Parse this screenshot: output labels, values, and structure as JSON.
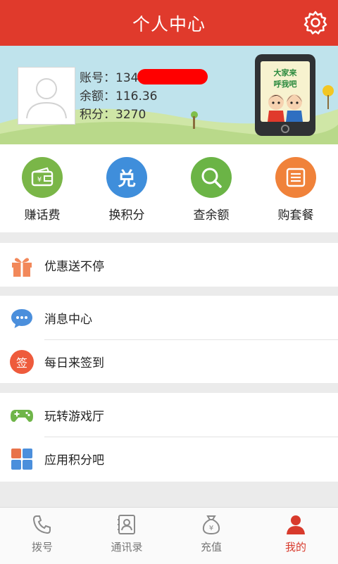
{
  "header": {
    "title": "个人中心",
    "settings_icon": "gear-icon"
  },
  "profile": {
    "account_label": "账号：",
    "account_value": "134",
    "balance_label": "余额：",
    "balance_value": "116.36",
    "points_label": "积分：",
    "points_value": "3270",
    "promo_line1": "大家来",
    "promo_line2": "呼我吧"
  },
  "actions": [
    {
      "label": "赚话费",
      "icon": "wallet-icon",
      "color": "#7ab648"
    },
    {
      "label": "换积分",
      "icon": "exchange-icon",
      "glyph": "兑",
      "color": "#3f8edb"
    },
    {
      "label": "查余额",
      "icon": "search-icon",
      "color": "#6bb446"
    },
    {
      "label": "购套餐",
      "icon": "list-icon",
      "color": "#f0823a"
    }
  ],
  "menu": [
    {
      "label": "优惠送不停",
      "icon": "gift-icon"
    },
    {
      "label": "消息中心",
      "icon": "chat-icon"
    },
    {
      "label": "每日来签到",
      "icon": "sign-in-icon",
      "glyph": "签"
    },
    {
      "label": "玩转游戏厅",
      "icon": "gamepad-icon"
    },
    {
      "label": "应用积分吧",
      "icon": "apps-icon"
    }
  ],
  "bottom_nav": [
    {
      "label": "拨号",
      "icon": "phone-icon"
    },
    {
      "label": "通讯录",
      "icon": "contacts-icon"
    },
    {
      "label": "充值",
      "icon": "money-bag-icon"
    },
    {
      "label": "我的",
      "icon": "user-icon",
      "active": true
    }
  ],
  "colors": {
    "header_bg": "#e03a2c",
    "active_tab": "#d83a2c"
  }
}
